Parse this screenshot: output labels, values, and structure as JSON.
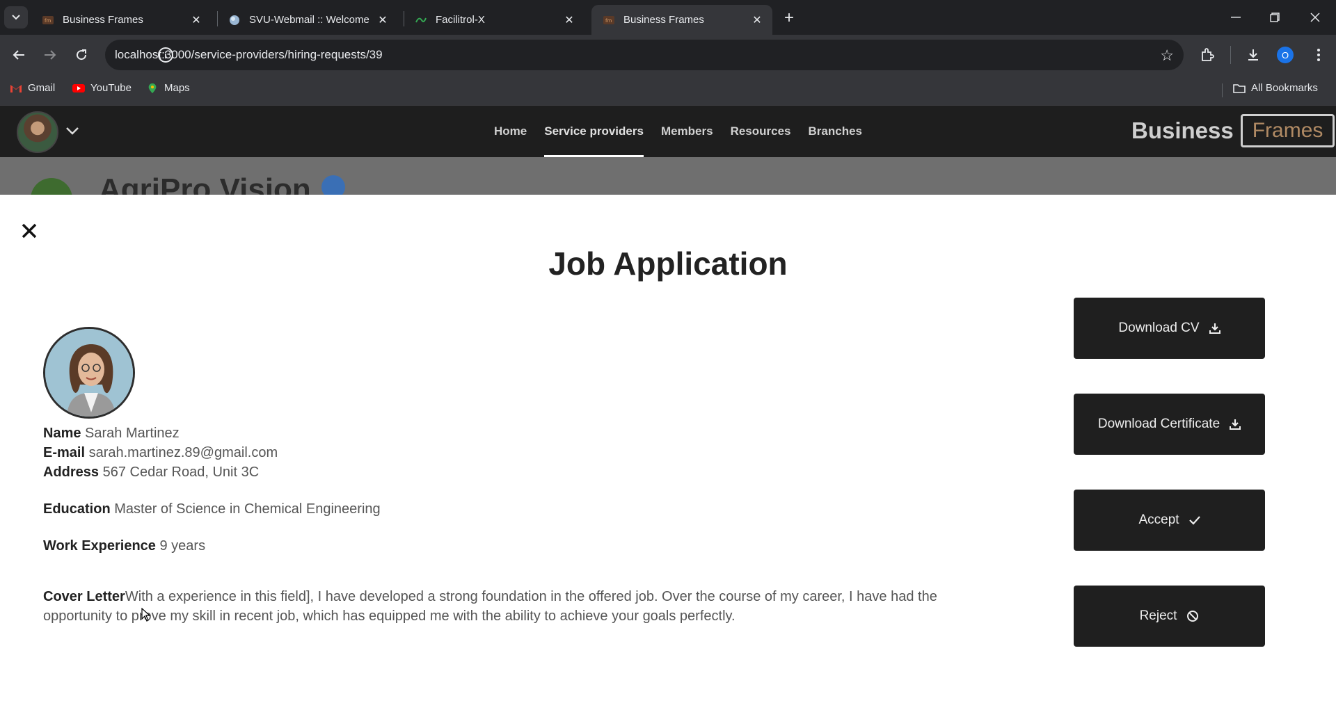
{
  "browser": {
    "tabs": [
      {
        "title": "Business Frames",
        "active": false
      },
      {
        "title": "SVU-Webmail :: Welcome",
        "active": false
      },
      {
        "title": "Facilitrol-X",
        "active": false
      },
      {
        "title": "Business Frames",
        "active": true
      }
    ],
    "url": "localhost:3000/service-providers/hiring-requests/39",
    "profile_initial": "O",
    "bookmarks": [
      "Gmail",
      "YouTube",
      "Maps"
    ],
    "all_bookmarks": "All Bookmarks"
  },
  "appnav": {
    "links": [
      "Home",
      "Service providers",
      "Members",
      "Resources",
      "Branches"
    ],
    "active": "Service providers",
    "brand_main": "Business",
    "brand_accent": "Frames"
  },
  "background_page": {
    "org_name": "AgriPro Vision"
  },
  "modal": {
    "title": "Job Application",
    "applicant": {
      "name_label": "Name",
      "name": "Sarah Martinez",
      "email_label": "E-mail",
      "email": "sarah.martinez.89@gmail.com",
      "address_label": "Address",
      "address": "567 Cedar Road, Unit 3C",
      "education_label": "Education",
      "education": "Master of Science in Chemical Engineering",
      "experience_label": "Work Experience",
      "experience": "9 years",
      "cover_label": "Cover Letter",
      "cover": "With a experience in this field], I have developed a strong foundation in the offered job. Over the course of my career, I have had the opportunity to prove my skill in recent job, which has equipped me with the ability to achieve your goals perfectly."
    },
    "actions": {
      "download_cv": "Download CV",
      "download_certificate": "Download Certificate",
      "accept": "Accept",
      "reject": "Reject"
    }
  }
}
